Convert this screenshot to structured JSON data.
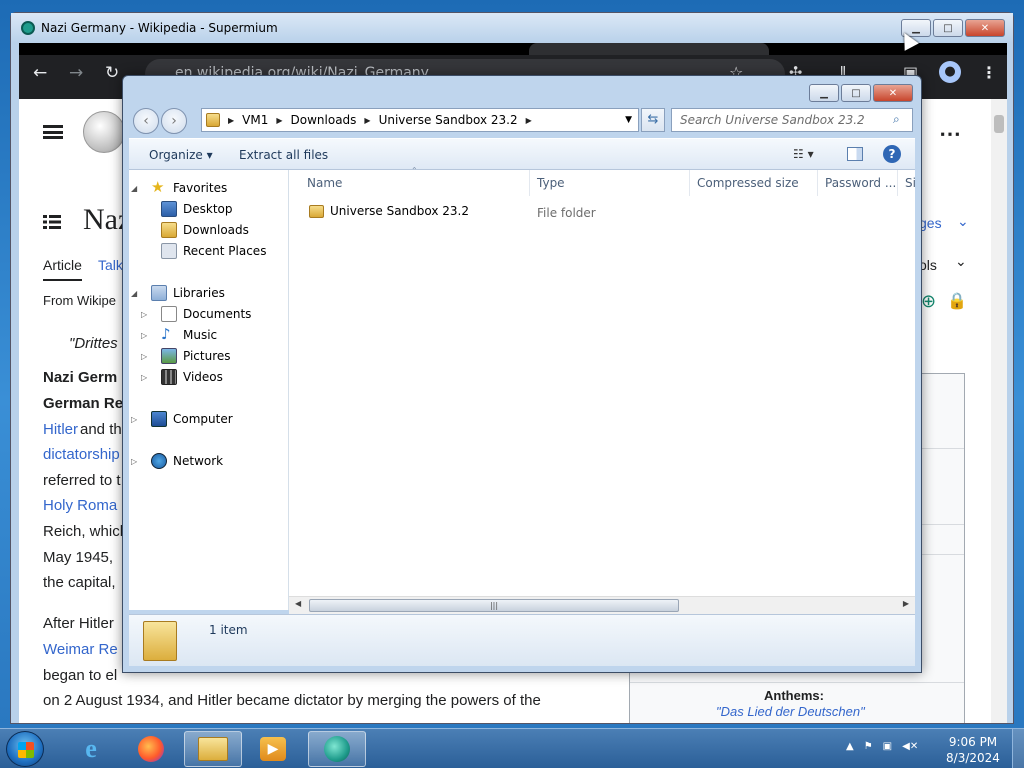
{
  "browser": {
    "title": "Nazi Germany - Wikipedia - Supermium",
    "url": "en.wikipedia.org/wiki/Nazi_Germany",
    "nav": {
      "back": "←",
      "forward": "→",
      "reload": "↻"
    },
    "icons": [
      "star-icon",
      "extensions-icon",
      "menu-icon",
      "profile-icon"
    ],
    "profile_glyph": "●",
    "more_glyph": "⋮"
  },
  "wiki": {
    "title_fragment": "Naz",
    "tabs": {
      "article": "Article",
      "talk": "Talk"
    },
    "from": "From Wikipe",
    "languages_fragment": "ges",
    "tools_fragment": "ols",
    "quote": "\"Drittes",
    "para1": [
      {
        "text": "Nazi Germ",
        "link": false,
        "bold": true
      },
      {
        "text": "German Re",
        "link": false,
        "bold": true
      },
      {
        "text": "Hitler",
        "link": true
      },
      {
        "text": " and th",
        "link": false
      },
      {
        "text": "dictatorship",
        "link": true
      },
      {
        "text": "referred to t",
        "link": false
      },
      {
        "text": "Holy Roma",
        "link": true
      },
      {
        "text": "Reich, which",
        "link": false
      },
      {
        "text": "May 1945,",
        "link": false
      },
      {
        "text": "the capital,",
        "link": false
      }
    ],
    "para2": [
      {
        "text": "After Hitler",
        "link": false
      },
      {
        "text": "Weimar Re",
        "link": true
      },
      {
        "text": "began to el",
        "link": false
      },
      {
        "text": "on 2 August 1934, and Hitler became dictator by merging the powers of the",
        "link": false
      }
    ],
    "anthems_label": "Anthems:",
    "anthem": "\"Das Lied der Deutschen\""
  },
  "explorer": {
    "breadcrumb": [
      "VM1",
      "Downloads",
      "Universe Sandbox 23.2"
    ],
    "search_placeholder": "Search Universe Sandbox 23.2",
    "commands": {
      "organize": "Organize ▾",
      "extract": "Extract all files"
    },
    "nav": {
      "favorites": "Favorites",
      "favorites_items": [
        "Desktop",
        "Downloads",
        "Recent Places"
      ],
      "libraries": "Libraries",
      "libraries_items": [
        "Documents",
        "Music",
        "Pictures",
        "Videos"
      ],
      "computer": "Computer",
      "network": "Network"
    },
    "columns": [
      "Name",
      "Type",
      "Compressed size",
      "Password ...",
      "Si"
    ],
    "files": [
      {
        "name": "Universe Sandbox 23.2",
        "type": "File folder"
      }
    ],
    "status": "1 item"
  },
  "taskbar": {
    "time": "9:06 PM",
    "date": "8/3/2024",
    "apps": [
      "start-button",
      "internet-explorer",
      "firefox",
      "file-explorer",
      "media-player",
      "supermium"
    ]
  }
}
